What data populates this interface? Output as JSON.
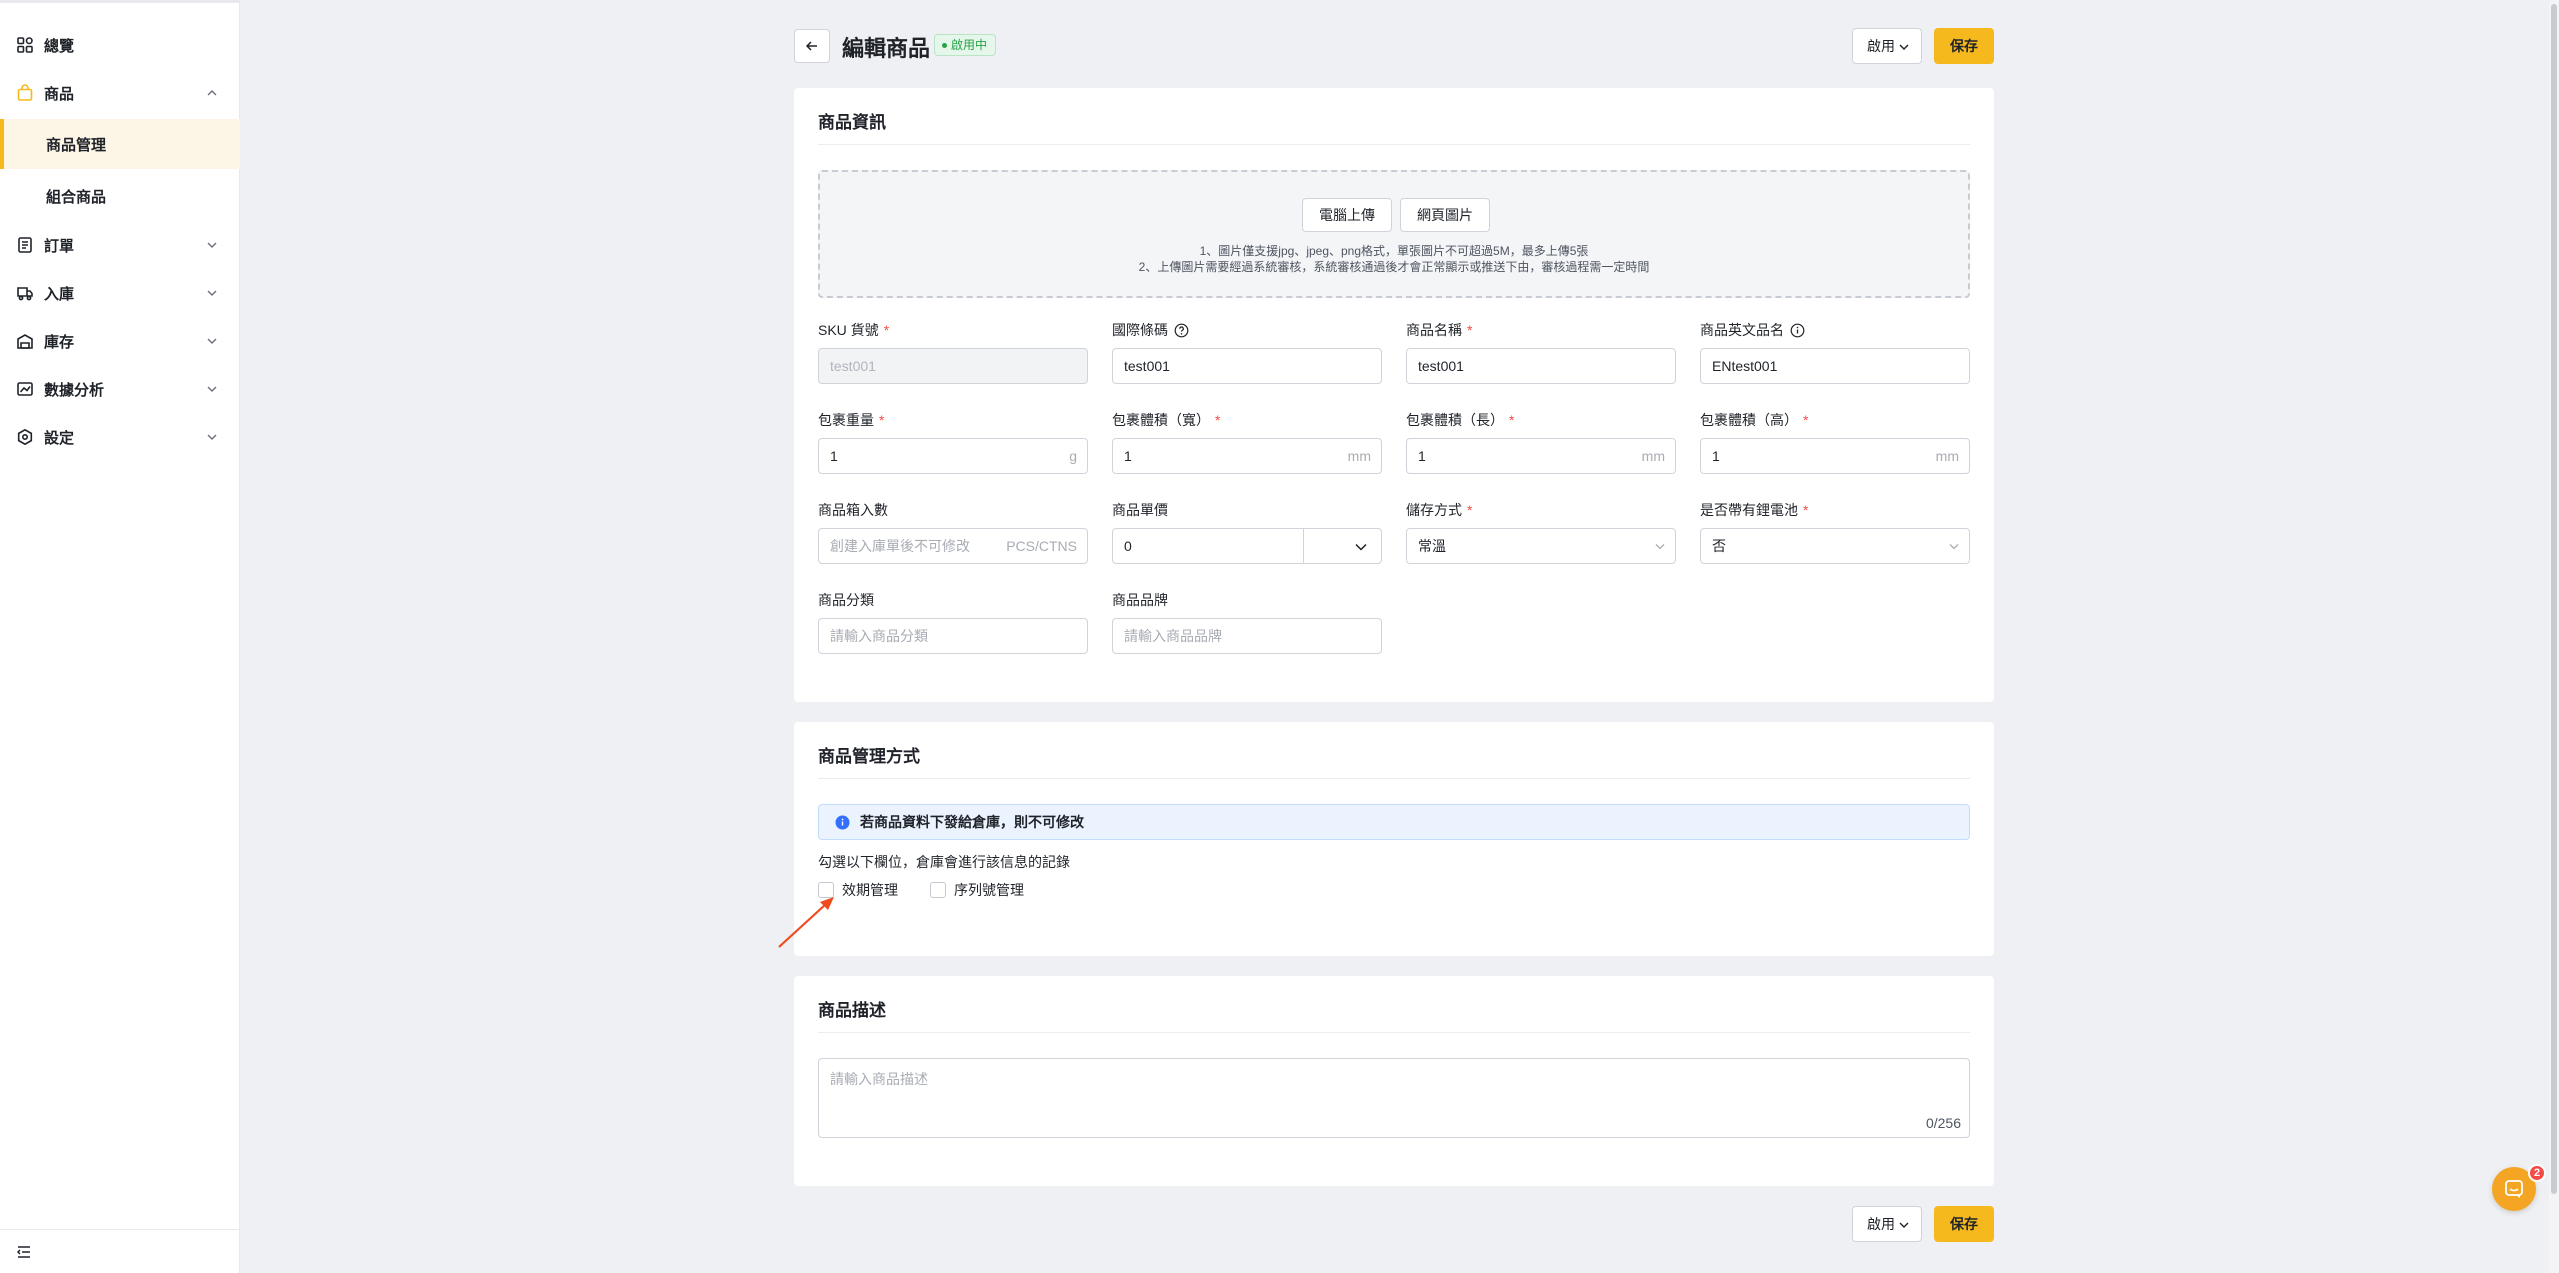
{
  "sidebar": {
    "items": [
      {
        "label": "總覽",
        "icon": "dashboard-icon"
      },
      {
        "label": "商品",
        "icon": "bag-icon"
      },
      {
        "label": "訂單",
        "icon": "order-icon"
      },
      {
        "label": "入庫",
        "icon": "truck-icon"
      },
      {
        "label": "庫存",
        "icon": "warehouse-icon"
      },
      {
        "label": "數據分析",
        "icon": "chart-icon"
      },
      {
        "label": "設定",
        "icon": "hexagon-icon"
      }
    ],
    "sub_items": [
      {
        "label": "商品管理",
        "active": true
      },
      {
        "label": "組合商品",
        "active": false
      }
    ],
    "accent": "#f5b91e"
  },
  "header": {
    "title": "編輯商品",
    "status": "啟用中",
    "status_select": "啟用",
    "save_label": "保存"
  },
  "product_info": {
    "title": "商品資訊",
    "upload_computer": "電腦上傳",
    "upload_web": "網頁圖片",
    "hint_1": "1、圖片僅支援jpg、jpeg、png格式，單張圖片不可超過5M，最多上傳5張",
    "hint_2": "2、上傳圖片需要經過系統審核，系統審核通過後才會正常顯示或推送下由，審核過程需一定時間",
    "fields": {
      "sku": {
        "label": "SKU 貨號",
        "value": "test001"
      },
      "barcode": {
        "label": "國際條碼",
        "value": "test001"
      },
      "name": {
        "label": "商品名稱",
        "value": "test001"
      },
      "name_en": {
        "label": "商品英文品名",
        "value": "ENtest001"
      },
      "weight": {
        "label": "包裹重量",
        "value": "1",
        "unit": "g"
      },
      "width": {
        "label": "包裹體積（寬）",
        "value": "1",
        "unit": "mm"
      },
      "length": {
        "label": "包裹體積（長）",
        "value": "1",
        "unit": "mm"
      },
      "height": {
        "label": "包裹體積（高）",
        "value": "1",
        "unit": "mm"
      },
      "box_qty": {
        "label": "商品箱入數",
        "placeholder": "創建入庫單後不可修改",
        "unit": "PCS/CTNS"
      },
      "unit_price": {
        "label": "商品單價",
        "value": "0"
      },
      "storage": {
        "label": "儲存方式",
        "value": "常溫"
      },
      "battery": {
        "label": "是否帶有鋰電池",
        "value": "否"
      },
      "category": {
        "label": "商品分類",
        "placeholder": "請輸入商品分類"
      },
      "brand": {
        "label": "商品品牌",
        "placeholder": "請輸入商品品牌"
      }
    }
  },
  "management": {
    "title": "商品管理方式",
    "alert": "若商品資料下發給倉庫，則不可修改",
    "hint": "勾選以下欄位，倉庫會進行該信息的記錄",
    "expiry": "效期管理",
    "serial": "序列號管理"
  },
  "description": {
    "title": "商品描述",
    "placeholder": "請輸入商品描述",
    "count": "0/256"
  },
  "chat_badge": "2"
}
